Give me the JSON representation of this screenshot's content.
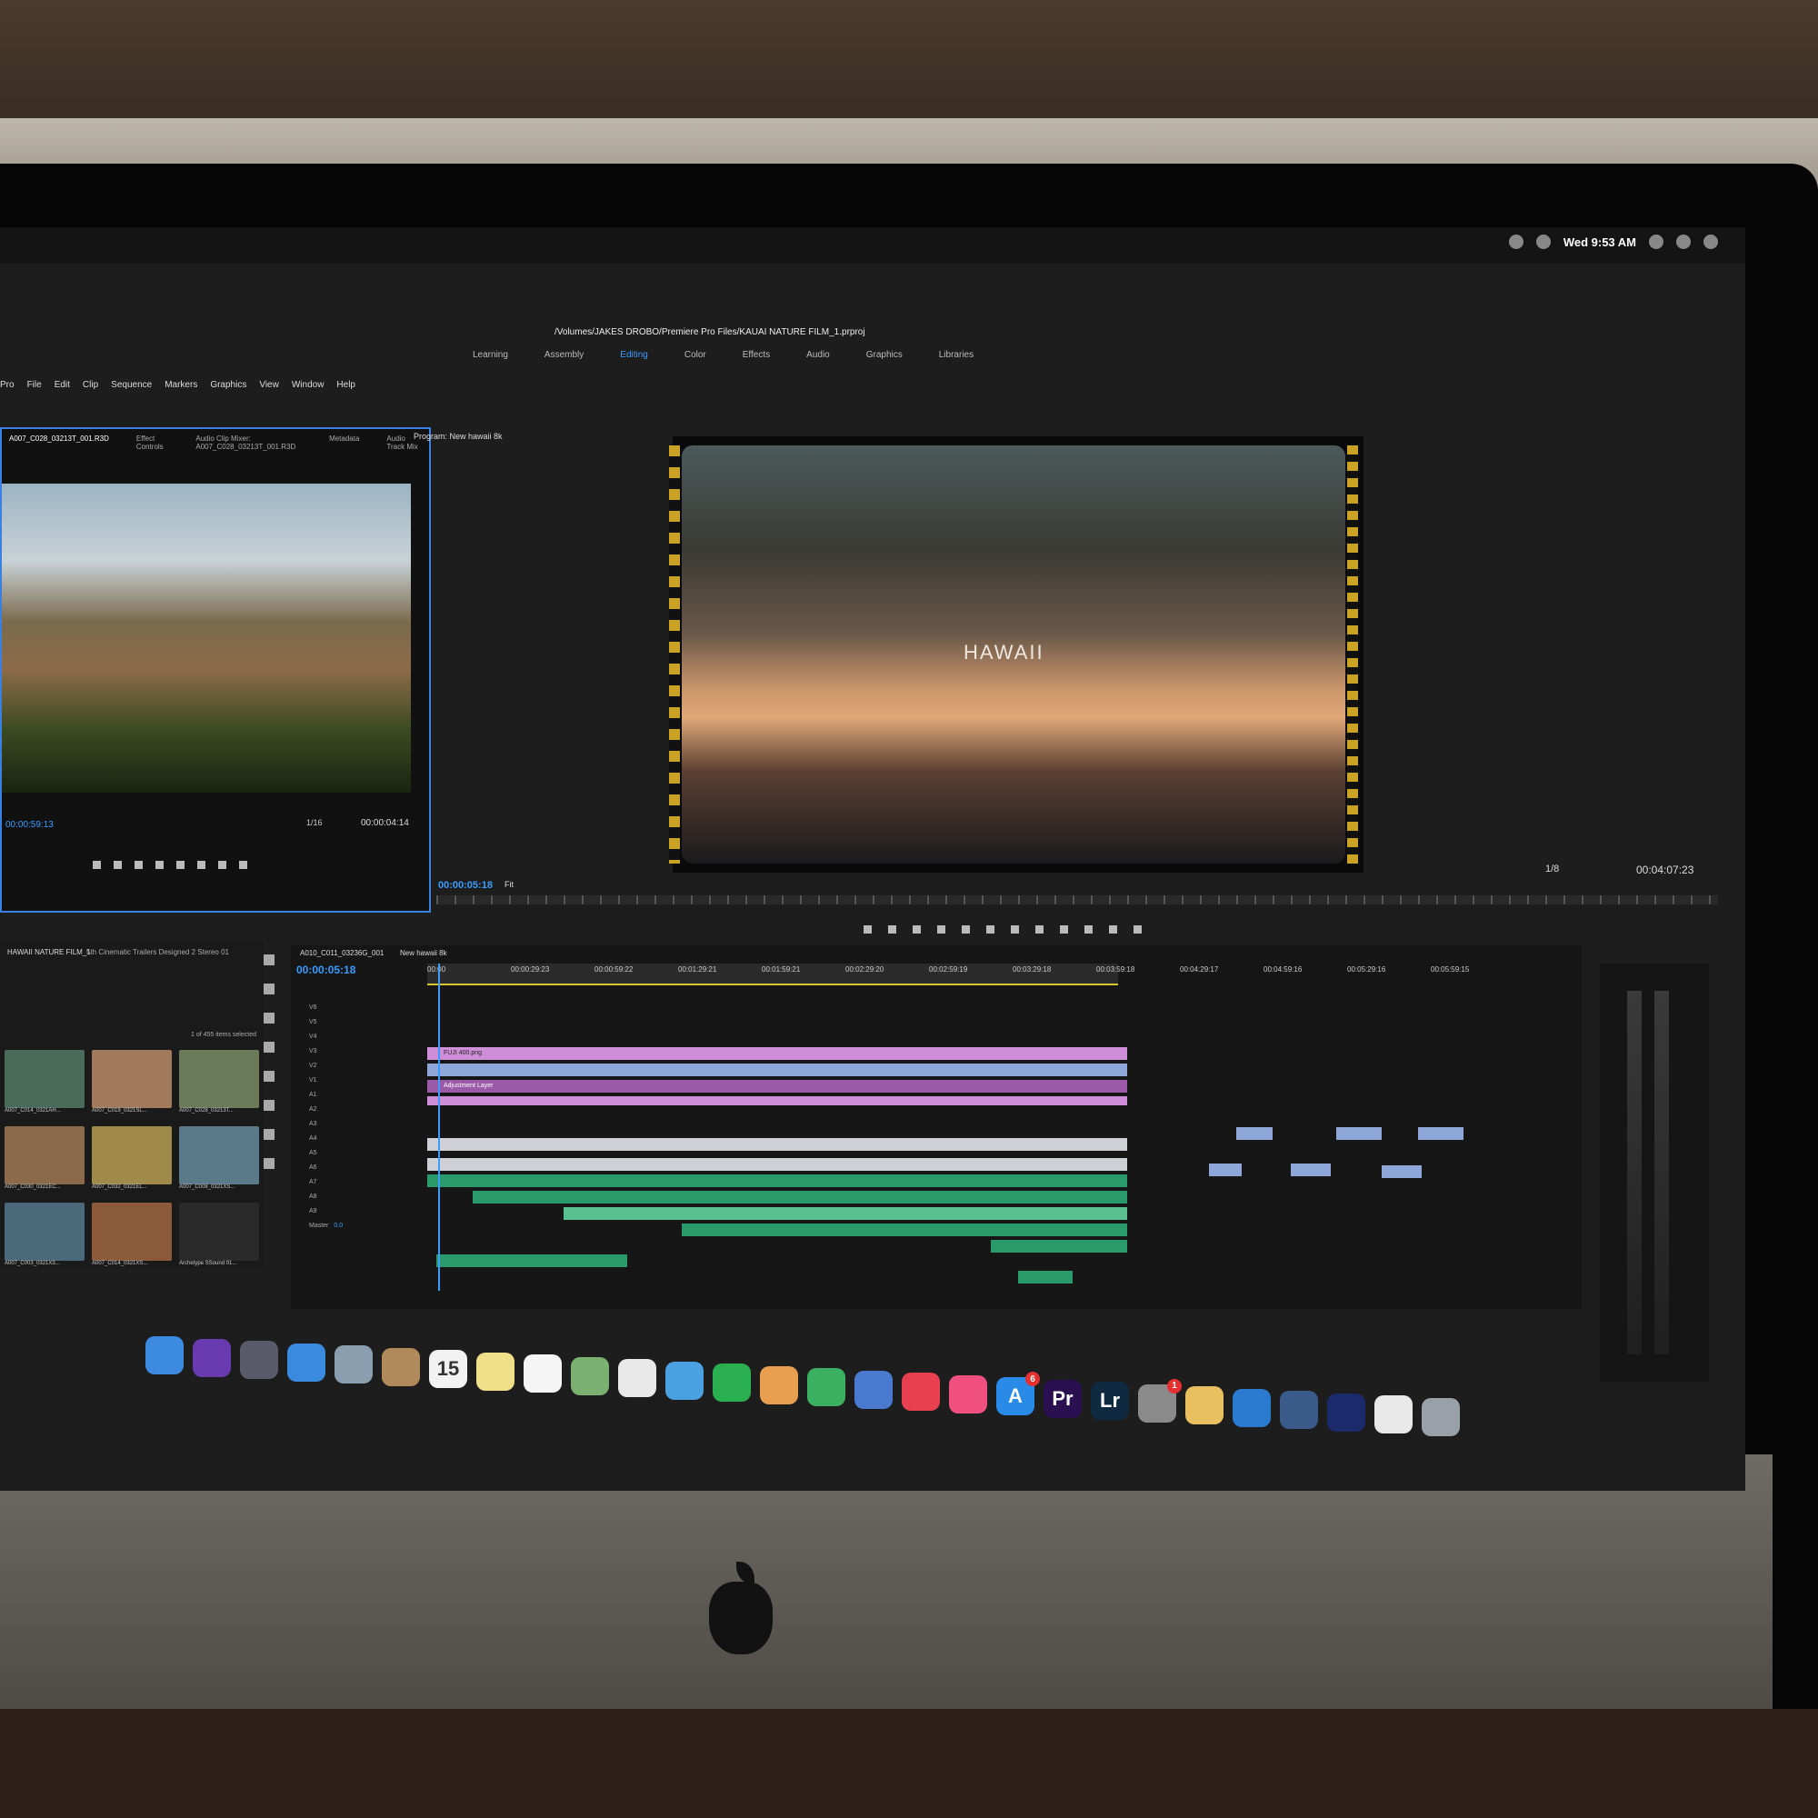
{
  "menubar": {
    "menus": [
      "Pro",
      "File",
      "Edit",
      "Clip",
      "Sequence",
      "Markers",
      "Graphics",
      "View",
      "Window",
      "Help"
    ],
    "clock": "Wed 9:53 AM"
  },
  "project_path": "/Volumes/JAKES DROBO/Premiere Pro Files/KAUAI NATURE FILM_1.prproj",
  "workspaces": [
    "Learning",
    "Assembly",
    "Editing",
    "Color",
    "Effects",
    "Audio",
    "Graphics",
    "Libraries"
  ],
  "active_workspace": "Editing",
  "source": {
    "tabs": [
      "A007_C028_03213T_001.R3D",
      "Effect Controls",
      "Audio Clip Mixer: A007_C028_03213T_001.R3D",
      "Metadata",
      "Audio Track Mix"
    ],
    "timecode": "00:00:04:14",
    "zoom": "1/16",
    "left_tc": "00:00:59:13"
  },
  "program": {
    "label": "Program: New hawaii 8k",
    "title_overlay": "HAWAII",
    "timecode": "00:00:05:18",
    "fit": "Fit",
    "zoom": "1/8",
    "duration": "00:04:07:23"
  },
  "project": {
    "tab": "HAWAII NATURE FILM_1",
    "tab2": "5th Cinematic Trailers Designed 2 Stereo 01",
    "selection": "1 of 455 items selected",
    "items": [
      {
        "name": "A007_C014_0321AH...",
        "color": "#4a6a5a"
      },
      {
        "name": "A007_C019_0321SL...",
        "color": "#a07a5a"
      },
      {
        "name": "A007_C028_03213T...",
        "color": "#6a7a5a"
      },
      {
        "name": "A007_C030_0321EC...",
        "color": "#8a6a4a"
      },
      {
        "name": "A007_C032_0321EL...",
        "color": "#a08a4a"
      },
      {
        "name": "A007_C008_0321XS...",
        "color": "#5a7a8a"
      },
      {
        "name": "A007_C003_0321X3...",
        "color": "#4a6a7a"
      },
      {
        "name": "A007_C014_0321XS...",
        "color": "#8a5a3a"
      },
      {
        "name": "Archetype SSound 01...",
        "color": "#2a2a2a"
      }
    ]
  },
  "timeline": {
    "tabs": [
      "A010_C011_03236G_001",
      "New hawaii 8k"
    ],
    "timecode": "00:00:05:18",
    "ruler": [
      "00:00",
      "00:00:29:23",
      "00:00:59:22",
      "00:01:29:21",
      "00:01:59:21",
      "00:02:29:20",
      "00:02:59:19",
      "00:03:29:18",
      "00:03:59:18",
      "00:04:29:17",
      "00:04:59:16",
      "00:05:29:16",
      "00:05:59:15"
    ],
    "clip_labels": {
      "fuji": "FUJI 400.png",
      "adjust": "Adjustment Layer"
    },
    "tracks": [
      "V6",
      "V5",
      "V4",
      "V3",
      "V2",
      "V1",
      "A1",
      "A2",
      "A3",
      "A4",
      "A5",
      "A6",
      "A7",
      "A8",
      "A9"
    ],
    "master": "Master",
    "master_val": "0.0"
  },
  "dock": {
    "apps": [
      {
        "name": "Finder",
        "color": "#3d8be0",
        "glyph": ""
      },
      {
        "name": "Siri",
        "color": "#6a3ab0",
        "glyph": ""
      },
      {
        "name": "Launchpad",
        "color": "#5a5a6a",
        "glyph": ""
      },
      {
        "name": "Safari",
        "color": "#3a8ae0",
        "glyph": ""
      },
      {
        "name": "Mail",
        "color": "#8aa0b0",
        "glyph": ""
      },
      {
        "name": "Contacts",
        "color": "#b08a5a",
        "glyph": ""
      },
      {
        "name": "Calendar",
        "color": "#f2f2f2",
        "glyph": "15"
      },
      {
        "name": "Notes",
        "color": "#f0e08a",
        "glyph": ""
      },
      {
        "name": "Reminders",
        "color": "#f5f5f5",
        "glyph": ""
      },
      {
        "name": "Maps",
        "color": "#7ab070",
        "glyph": ""
      },
      {
        "name": "Photos",
        "color": "#e8e8e8",
        "glyph": ""
      },
      {
        "name": "Messages",
        "color": "#4aa0e0",
        "glyph": ""
      },
      {
        "name": "FaceTime",
        "color": "#2ab050",
        "glyph": ""
      },
      {
        "name": "Pages",
        "color": "#e8a050",
        "glyph": ""
      },
      {
        "name": "Numbers",
        "color": "#3ab060",
        "glyph": ""
      },
      {
        "name": "Keynote",
        "color": "#4a7ad0",
        "glyph": ""
      },
      {
        "name": "News",
        "color": "#e84050",
        "glyph": ""
      },
      {
        "name": "iTunes",
        "color": "#f05080",
        "glyph": ""
      },
      {
        "name": "App Store",
        "color": "#2a8ae8",
        "glyph": "A",
        "badge": "6"
      },
      {
        "name": "Premiere Pro",
        "color": "#2a1050",
        "glyph": "Pr"
      },
      {
        "name": "Lightroom",
        "color": "#0f2a40",
        "glyph": "Lr"
      },
      {
        "name": "System Preferences",
        "color": "#8a8a8a",
        "glyph": "",
        "badge": "1"
      },
      {
        "name": "Music Folder",
        "color": "#e8c060",
        "glyph": ""
      },
      {
        "name": "Prime",
        "color": "#2a7ad0",
        "glyph": ""
      },
      {
        "name": "QuickTime",
        "color": "#3a5a8a",
        "glyph": ""
      },
      {
        "name": "Media Encoder",
        "color": "#1a2a6a",
        "glyph": ""
      },
      {
        "name": "Document",
        "color": "#e8e8e8",
        "glyph": ""
      },
      {
        "name": "Trash",
        "color": "#9aa0a8",
        "glyph": ""
      }
    ]
  }
}
